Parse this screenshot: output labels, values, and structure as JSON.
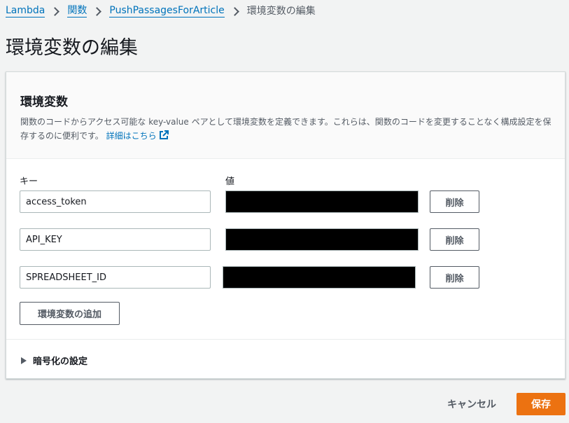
{
  "breadcrumb": {
    "items": [
      "Lambda",
      "関数",
      "PushPassagesForArticle"
    ],
    "current": "環境変数の編集"
  },
  "page": {
    "title": "環境変数の編集"
  },
  "panel": {
    "title": "環境変数",
    "description": "関数のコードからアクセス可能な key-value ペアとして環境変数を定義できます。これらは、関数のコードを変更することなく構成設定を保存するのに便利です。",
    "learn_more": "詳細はこちら"
  },
  "columns": {
    "key": "キー",
    "value": "値"
  },
  "variables": [
    {
      "key": "access_token",
      "value": "",
      "remove_label": "削除"
    },
    {
      "key": "API_KEY",
      "value": "",
      "remove_label": "削除"
    },
    {
      "key": "SPREADSHEET_ID",
      "value": "",
      "remove_label": "削除"
    }
  ],
  "add_button": "環境変数の追加",
  "encryption": {
    "label": "暗号化の設定"
  },
  "footer": {
    "cancel_label": "キャンセル",
    "save_label": "保存"
  },
  "colors": {
    "link": "#0073bb",
    "primary_button": "#ec7211",
    "redaction": "#000000"
  },
  "icons": [
    "chevron-right-icon",
    "external-link-icon",
    "caret-right-icon"
  ]
}
